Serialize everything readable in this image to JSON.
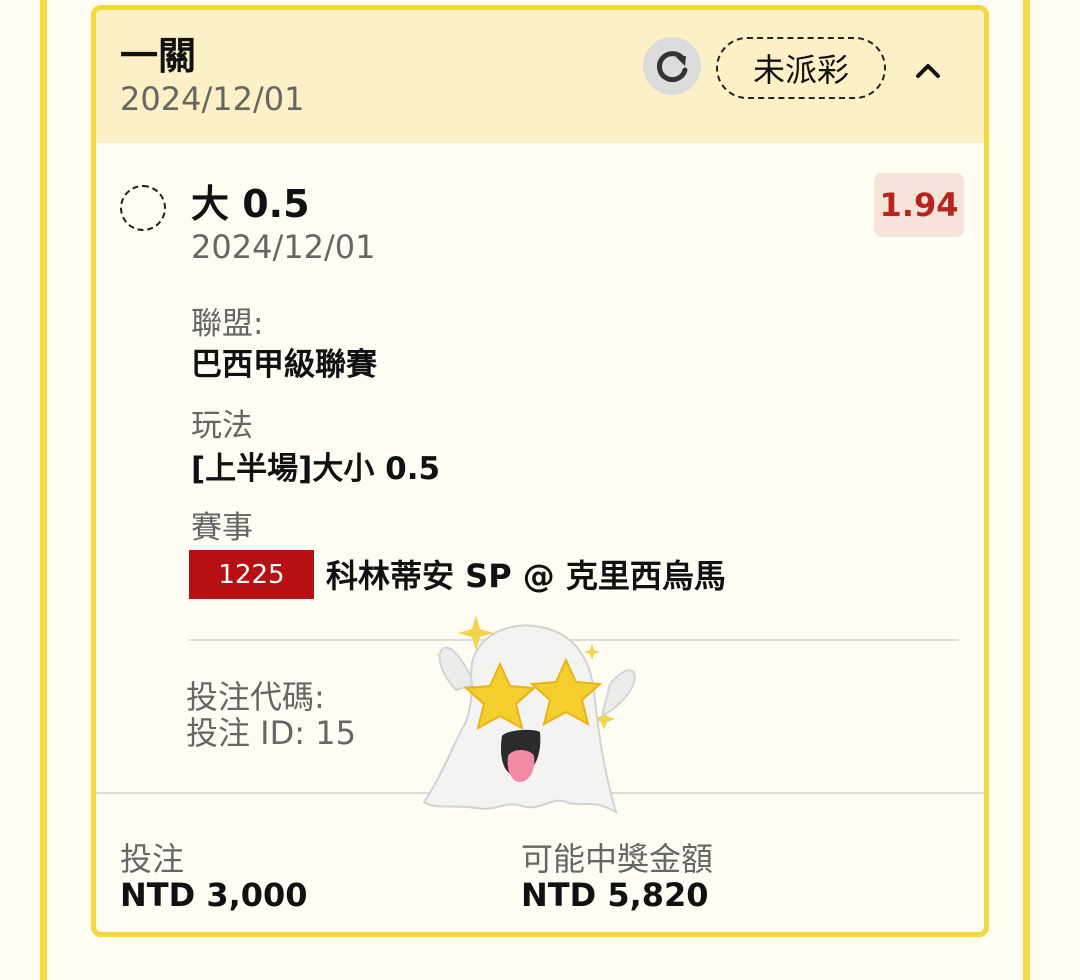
{
  "header": {
    "title": "一關",
    "date": "2024/12/01",
    "status": "未派彩",
    "refresh_icon": "refresh-icon",
    "collapse_icon": "chevron-up-icon"
  },
  "selection": {
    "name": "大 0.5",
    "date": "2024/12/01",
    "odds": "1.94"
  },
  "details": {
    "league_label": "聯盟:",
    "league_value": "巴西甲級聯賽",
    "market_label": "玩法",
    "market_value": "[上半場]大小 0.5",
    "match_label": "賽事",
    "match_id": "1225",
    "match_name": "科林蒂安 SP @ 克里西烏馬"
  },
  "bet_meta": {
    "code_text": "投注代碼:",
    "id_text": "投注 ID: 15"
  },
  "footer": {
    "stake_label": "投注",
    "stake_value": "NTD 3,000",
    "payout_label": "可能中獎金額",
    "payout_value": "NTD 5,820"
  },
  "colors": {
    "accent_border": "#f5d73e",
    "header_bg": "#fcf0c6",
    "odds_text": "#b8241b",
    "odds_bg": "#f8e3da",
    "match_badge": "#b80f12"
  }
}
